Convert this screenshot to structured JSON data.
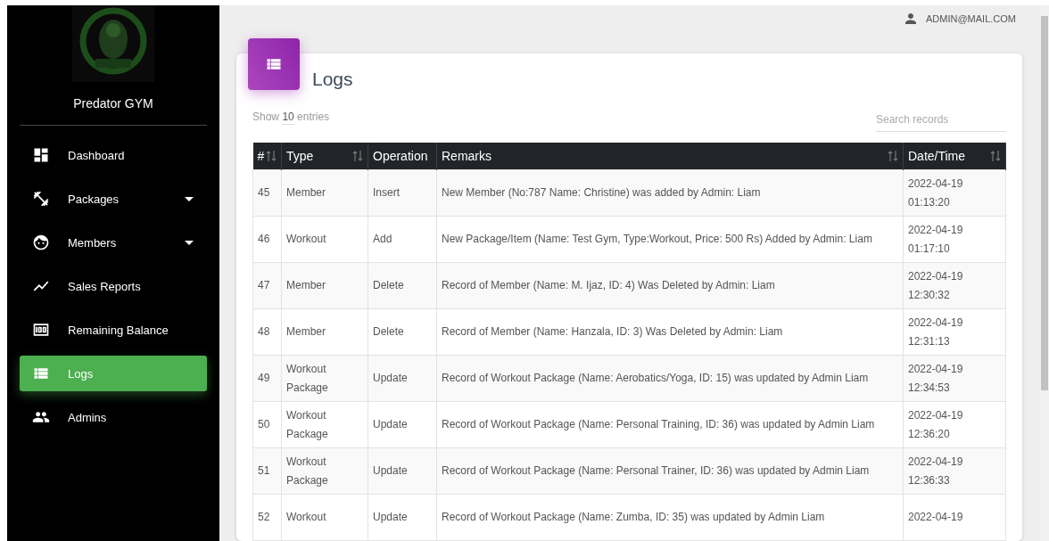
{
  "sidebar": {
    "brand": "Predator GYM",
    "items": [
      {
        "label": "Dashboard",
        "selected": false,
        "expandable": false
      },
      {
        "label": "Packages",
        "selected": false,
        "expandable": true
      },
      {
        "label": "Members",
        "selected": false,
        "expandable": true
      },
      {
        "label": "Sales Reports",
        "selected": false,
        "expandable": false
      },
      {
        "label": "Remaining Balance",
        "selected": false,
        "expandable": false
      },
      {
        "label": "Logs",
        "selected": true,
        "expandable": false
      },
      {
        "label": "Admins",
        "selected": false,
        "expandable": false
      }
    ]
  },
  "user": {
    "email": "ADMIN@MAIL.COM"
  },
  "card": {
    "title": "Logs",
    "length_prefix": "Show",
    "length_value": "10",
    "length_suffix": "entries",
    "search": {
      "placeholder": "Search records"
    }
  },
  "table": {
    "columns": [
      "#",
      "Type",
      "Operation",
      "Remarks",
      "Date/Time"
    ],
    "rows": [
      {
        "cells": [
          "45",
          "Member",
          "Insert",
          "New Member (No:787 Name: Christine) was added by Admin: Liam"
        ],
        "date": "2022-04-19",
        "time": "01:13:20"
      },
      {
        "cells": [
          "46",
          "Workout",
          "Add",
          "New Package/Item (Name: Test Gym, Type:Workout, Price: 500 Rs) Added by Admin: Liam"
        ],
        "date": "2022-04-19",
        "time": "01:17:10"
      },
      {
        "cells": [
          "47",
          "Member",
          "Delete",
          "Record of Member (Name: M. Ijaz, ID: 4) Was Deleted by Admin: Liam"
        ],
        "date": "2022-04-19",
        "time": "12:30:32"
      },
      {
        "cells": [
          "48",
          "Member",
          "Delete",
          "Record of Member (Name: Hanzala, ID: 3) Was Deleted by Admin: Liam"
        ],
        "date": "2022-04-19",
        "time": "12:31:13"
      },
      {
        "cells": [
          "49",
          "Workout Package",
          "Update",
          "Record of Workout Package (Name: Aerobatics/Yoga, ID: 15) was updated by Admin Liam"
        ],
        "date": "2022-04-19",
        "time": "12:34:53"
      },
      {
        "cells": [
          "50",
          "Workout Package",
          "Update",
          "Record of Workout Package (Name: Personal Training, ID: 36) was updated by Admin Liam"
        ],
        "date": "2022-04-19",
        "time": "12:36:20"
      },
      {
        "cells": [
          "51",
          "Workout Package",
          "Update",
          "Record of Workout Package (Name: Personal Trainer, ID: 36) was updated by Admin Liam"
        ],
        "date": "2022-04-19",
        "time": "12:36:33"
      },
      {
        "cells": [
          "52",
          "Workout",
          "Update",
          "Record of Workout Package (Name: Zumba, ID: 35) was updated by Admin Liam"
        ],
        "date": "2022-04-19"
      }
    ]
  }
}
